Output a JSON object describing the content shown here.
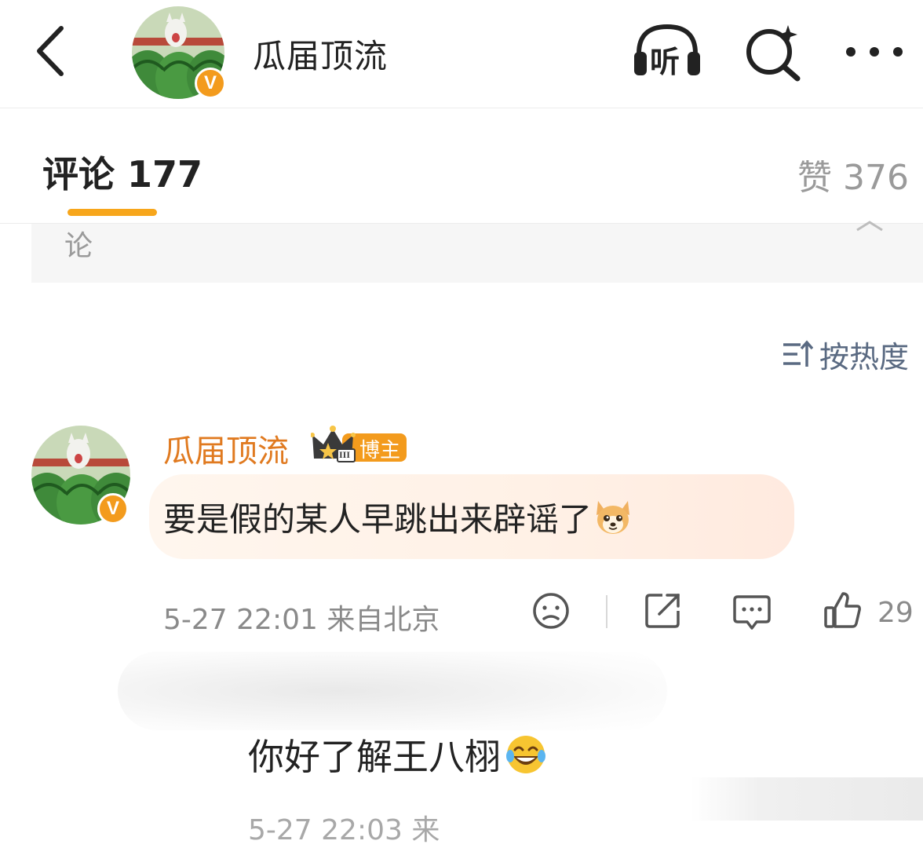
{
  "header": {
    "title": "瓜届顶流",
    "listen_label": "听",
    "verified_mark": "V",
    "icons": [
      "back-arrow-icon",
      "listen-headphones-icon",
      "search-ai-icon",
      "more-dots-icon"
    ]
  },
  "tabs": {
    "comments_label": "评论 177",
    "likes_label": "赞 376",
    "active_color": "#f7a61b"
  },
  "collapsed_panel": {
    "text": "论"
  },
  "sort": {
    "label": "按热度"
  },
  "comment": {
    "author": "瓜届顶流",
    "badge": "博主",
    "crown_level": "III",
    "text": "要是假的某人早跳出来辟谣了",
    "meta": "5-27 22:01 来自北京",
    "likes": "29",
    "name_color": "#e07a20"
  },
  "reply": {
    "text": "你好了解王八栩"
  },
  "bottom_partial": {
    "meta": "5-27 22:03 来"
  }
}
